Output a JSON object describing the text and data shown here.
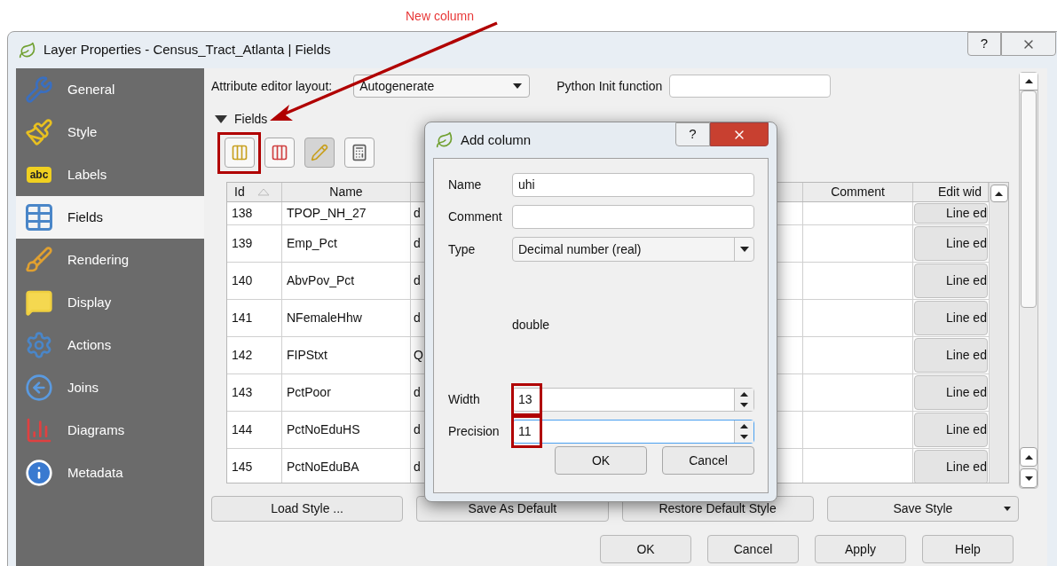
{
  "annotation": {
    "text": "New column"
  },
  "window": {
    "title": "Layer Properties - Census_Tract_Atlanta | Fields",
    "help_glyph": "?"
  },
  "sidebar": {
    "items": [
      {
        "label": "General",
        "selected": false
      },
      {
        "label": "Style",
        "selected": false
      },
      {
        "label": "Labels",
        "icon_text": "abc",
        "selected": false
      },
      {
        "label": "Fields",
        "selected": true
      },
      {
        "label": "Rendering",
        "selected": false
      },
      {
        "label": "Display",
        "selected": false
      },
      {
        "label": "Actions",
        "selected": false
      },
      {
        "label": "Joins",
        "selected": false
      },
      {
        "label": "Diagrams",
        "selected": false
      },
      {
        "label": "Metadata",
        "selected": false
      }
    ]
  },
  "editor": {
    "layout_label": "Attribute editor layout:",
    "layout_value": "Autogenerate",
    "python_label": "Python Init function"
  },
  "fields_section": {
    "title": "Fields",
    "expanded": true,
    "toolbar": [
      {
        "pressed": false,
        "highlighted": true
      },
      {
        "pressed": false
      },
      {
        "pressed": true
      },
      {
        "pressed": false
      }
    ]
  },
  "table": {
    "columns": [
      {
        "label": "Id",
        "sorted": true
      },
      {
        "label": "Name",
        "sorted": false
      },
      {
        "label": "Comment",
        "sorted": false
      },
      {
        "label": "Edit wid",
        "sorted": false
      }
    ],
    "rows": [
      {
        "id": "138",
        "name": "TPOP_NH_27",
        "type": "d",
        "edit_widget": "Line ed"
      },
      {
        "id": "139",
        "name": "Emp_Pct",
        "type": "d",
        "edit_widget": "Line ed"
      },
      {
        "id": "140",
        "name": "AbvPov_Pct",
        "type": "d",
        "edit_widget": "Line ed"
      },
      {
        "id": "141",
        "name": "NFemaleHhw",
        "type": "d",
        "edit_widget": "Line ed"
      },
      {
        "id": "142",
        "name": "FIPStxt",
        "type": "Q",
        "edit_widget": "Line ed"
      },
      {
        "id": "143",
        "name": "PctPoor",
        "type": "d",
        "edit_widget": "Line ed"
      },
      {
        "id": "144",
        "name": "PctNoEduHS",
        "type": "d",
        "edit_widget": "Line ed"
      },
      {
        "id": "145",
        "name": "PctNoEduBA",
        "type": "d",
        "edit_widget": "Line ed"
      }
    ]
  },
  "style_buttons": [
    "Load Style ...",
    "Save As Default",
    "Restore Default Style",
    "Save Style"
  ],
  "dialog_buttons": [
    "OK",
    "Cancel",
    "Apply",
    "Help"
  ],
  "add_column_dialog": {
    "title": "Add column",
    "help_glyph": "?",
    "name": {
      "label": "Name",
      "value": "uhi"
    },
    "comment": {
      "label": "Comment"
    },
    "type": {
      "label": "Type",
      "value": "Decimal number (real)",
      "note": "double"
    },
    "width": {
      "label": "Width",
      "value": "13",
      "focused": false,
      "highlighted": true
    },
    "precision": {
      "label": "Precision",
      "value": "11",
      "focused": true,
      "highlighted": true
    },
    "buttons": [
      "OK",
      "Cancel"
    ]
  }
}
